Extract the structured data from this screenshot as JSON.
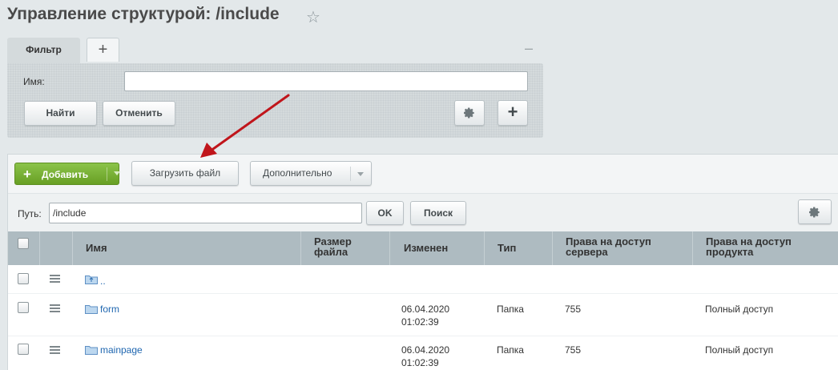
{
  "header": {
    "title": "Управление структурой: /include",
    "favorite_icon": "star-icon"
  },
  "filter": {
    "tab_label": "Фильтр",
    "add_tab_icon": "plus-icon",
    "minimize_icon": "minus-icon",
    "name_label": "Имя:",
    "name_value": "",
    "find_label": "Найти",
    "cancel_label": "Отменить",
    "settings_icon": "gear-icon",
    "add_field_icon": "plus-icon"
  },
  "toolbar": {
    "add_label": "Добавить",
    "upload_label": "Загрузить файл",
    "more_label": "Дополнительно"
  },
  "path": {
    "label": "Путь:",
    "value": "/include",
    "ok_label": "OK",
    "search_label": "Поиск"
  },
  "table": {
    "columns": [
      "Имя",
      "Размер файла",
      "Изменен",
      "Тип",
      "Права на доступ сервера",
      "Права на доступ продукта"
    ],
    "up_label": "..",
    "rows": [
      {
        "name": "form",
        "size": "",
        "modified_date": "06.04.2020",
        "modified_time": "01:02:39",
        "type": "Папка",
        "server_rights": "755",
        "product_rights": "Полный доступ"
      },
      {
        "name": "mainpage",
        "size": "",
        "modified_date": "06.04.2020",
        "modified_time": "01:02:39",
        "type": "Папка",
        "server_rights": "755",
        "product_rights": "Полный доступ"
      }
    ]
  },
  "colors": {
    "accent_green": "#7cb342",
    "link_blue": "#2067b0",
    "annotation_arrow": "#c0151b",
    "header_bg": "#aebbc1"
  }
}
